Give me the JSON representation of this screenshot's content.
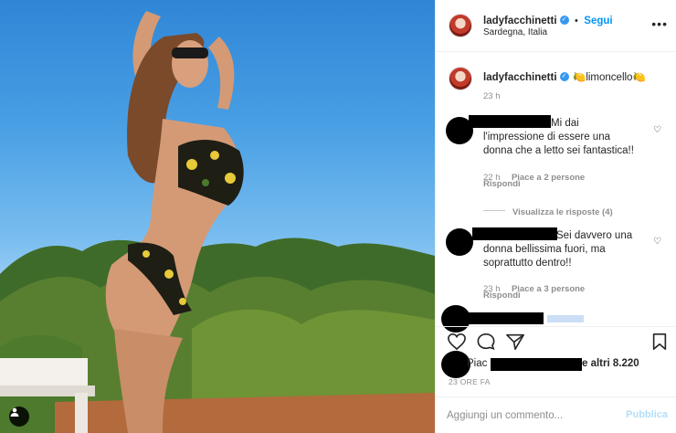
{
  "post": {
    "user": {
      "username": "ladyfacchinetti",
      "verified": true,
      "follow_label": "Segui",
      "separator": "•",
      "location": "Sardegna, Italia"
    },
    "caption": {
      "username": "ladyfacchinetti",
      "emoji_before": "🍋",
      "text": "limoncello",
      "emoji_after": "🍋",
      "time": "23 h"
    },
    "comments": [
      {
        "text": "Mi dai l'impressione di essere una donna che a letto sei fantastica!!",
        "time": "22 h",
        "likes": "Piace a 2 persone",
        "reply": "Rispondi",
        "view_replies": "Visualizza le risposte (4)"
      },
      {
        "text": "Sei davvero una donna bellissima fuori, ma soprattutto dentro!!",
        "time": "23 h",
        "likes": "Piace a 3 persone",
        "reply": "Rispondi"
      }
    ],
    "likes_prefix": "Piac",
    "likes_suffix": "e altri 8.220",
    "timestamp": "23 ORE FA",
    "comment_placeholder": "Aggiungi un commento...",
    "publish_label": "Pubblica"
  },
  "icons": {
    "verified": "verified-badge-icon",
    "more": "more-options-icon",
    "like": "heart-icon",
    "comment": "comment-bubble-icon",
    "share": "paper-plane-icon",
    "save": "bookmark-icon",
    "user_tag": "user-tag-icon"
  },
  "colors": {
    "link_blue": "#0095f6",
    "publish_disabled": "#b2dffc",
    "muted_text": "#8e8e8e",
    "verified": "#3897f0"
  }
}
